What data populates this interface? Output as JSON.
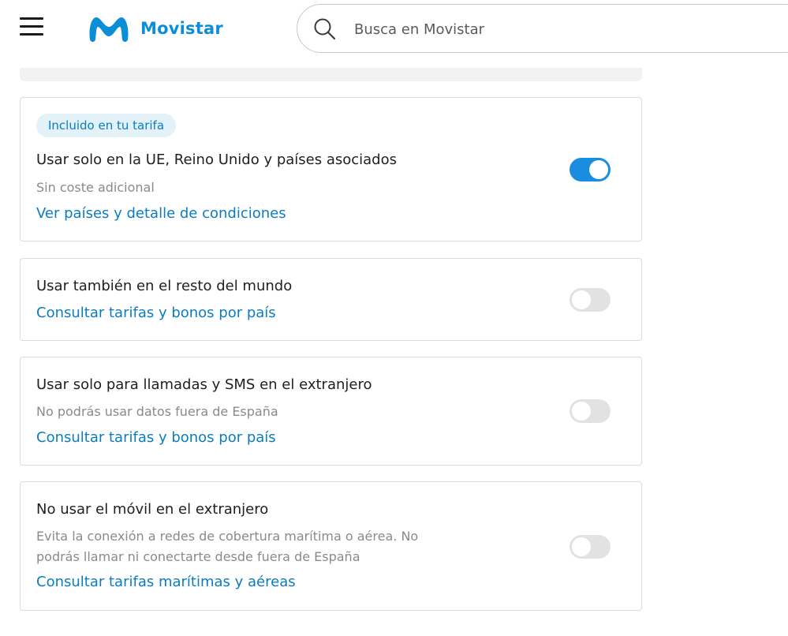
{
  "header": {
    "brand": "Movistar",
    "search_placeholder": "Busca en Movistar",
    "brand_color": "#0b8ed8"
  },
  "options": [
    {
      "badge": "Incluido en tu tarifa",
      "title": "Usar solo en la UE, Reino Unido y países asociados",
      "subtitle": "Sin coste adicional",
      "link": "Ver países y detalle de condiciones",
      "enabled": true
    },
    {
      "title": "Usar también en el resto del mundo",
      "link": "Consultar tarifas y bonos por país",
      "enabled": false
    },
    {
      "title": "Usar solo para llamadas y SMS en el extranjero",
      "subtitle": "No podrás usar datos fuera de España",
      "link": "Consultar tarifas y bonos por país",
      "enabled": false
    },
    {
      "title": "No usar el móvil en el extranjero",
      "subtitle_line1": "Evita la conexión a redes de cobertura marítima o aérea. No",
      "subtitle_line2": "podrás llamar ni conectarte desde fuera de España",
      "link": "Consultar tarifas marítimas y aéreas",
      "enabled": false
    }
  ],
  "colors": {
    "link": "#0b7dbf",
    "toggle_on": "#1a8de0",
    "toggle_off": "#e2e2e2"
  }
}
